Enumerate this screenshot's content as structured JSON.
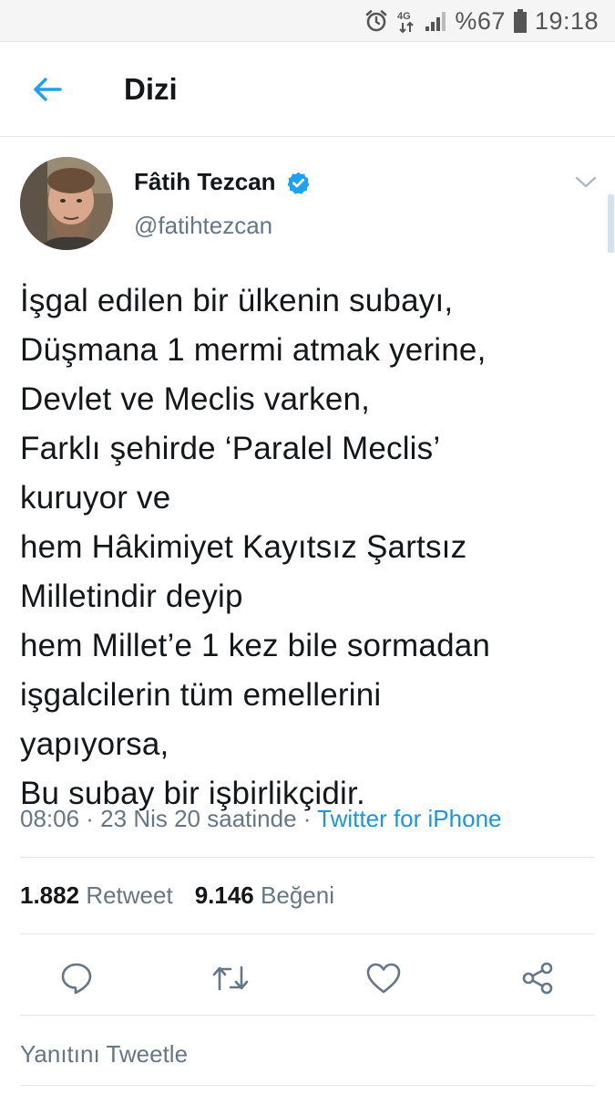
{
  "status_bar": {
    "battery": "%67",
    "time": "19:18",
    "network": "4G",
    "icons": [
      "alarm-icon",
      "network-4g-icon",
      "signal-icon",
      "battery-icon"
    ]
  },
  "header": {
    "title": "Dizi",
    "back_icon": "arrow-left-icon"
  },
  "tweet": {
    "author": {
      "name": "Fâtih Tezcan",
      "handle": "@fatihtezcan",
      "verified": true
    },
    "lines": [
      "İşgal edilen bir ülkenin subayı,",
      "Düşmana 1 mermi atmak yerine,",
      "Devlet ve Meclis varken,",
      "Farklı şehirde ‘Paralel Meclis’",
      "kuruyor ve",
      "hem Hâkimiyet Kayıtsız Şartsız",
      "Milletindir deyip",
      "hem Millet’e 1 kez bile sormadan",
      "işgalcilerin tüm emellerini",
      "yapıyorsa,",
      "Bu subay bir işbirlikçidir."
    ],
    "meta": {
      "time_date": "08:06 · 23 Nis 20 saatinde · ",
      "source": "Twitter for iPhone"
    },
    "stats": {
      "retweet_count": "1.882",
      "retweet_label": "Retweet",
      "like_count": "9.146",
      "like_label": "Beğeni"
    }
  },
  "actions": [
    "reply-icon",
    "retweet-icon",
    "like-icon",
    "share-icon"
  ],
  "reply": {
    "placeholder": "Yanıtını Tweetle"
  },
  "colors": {
    "accent": "#1da1f2",
    "link": "#1b95e0",
    "secondary_text": "#657786",
    "primary_text": "#14171a",
    "divider": "#e1e8ed"
  }
}
